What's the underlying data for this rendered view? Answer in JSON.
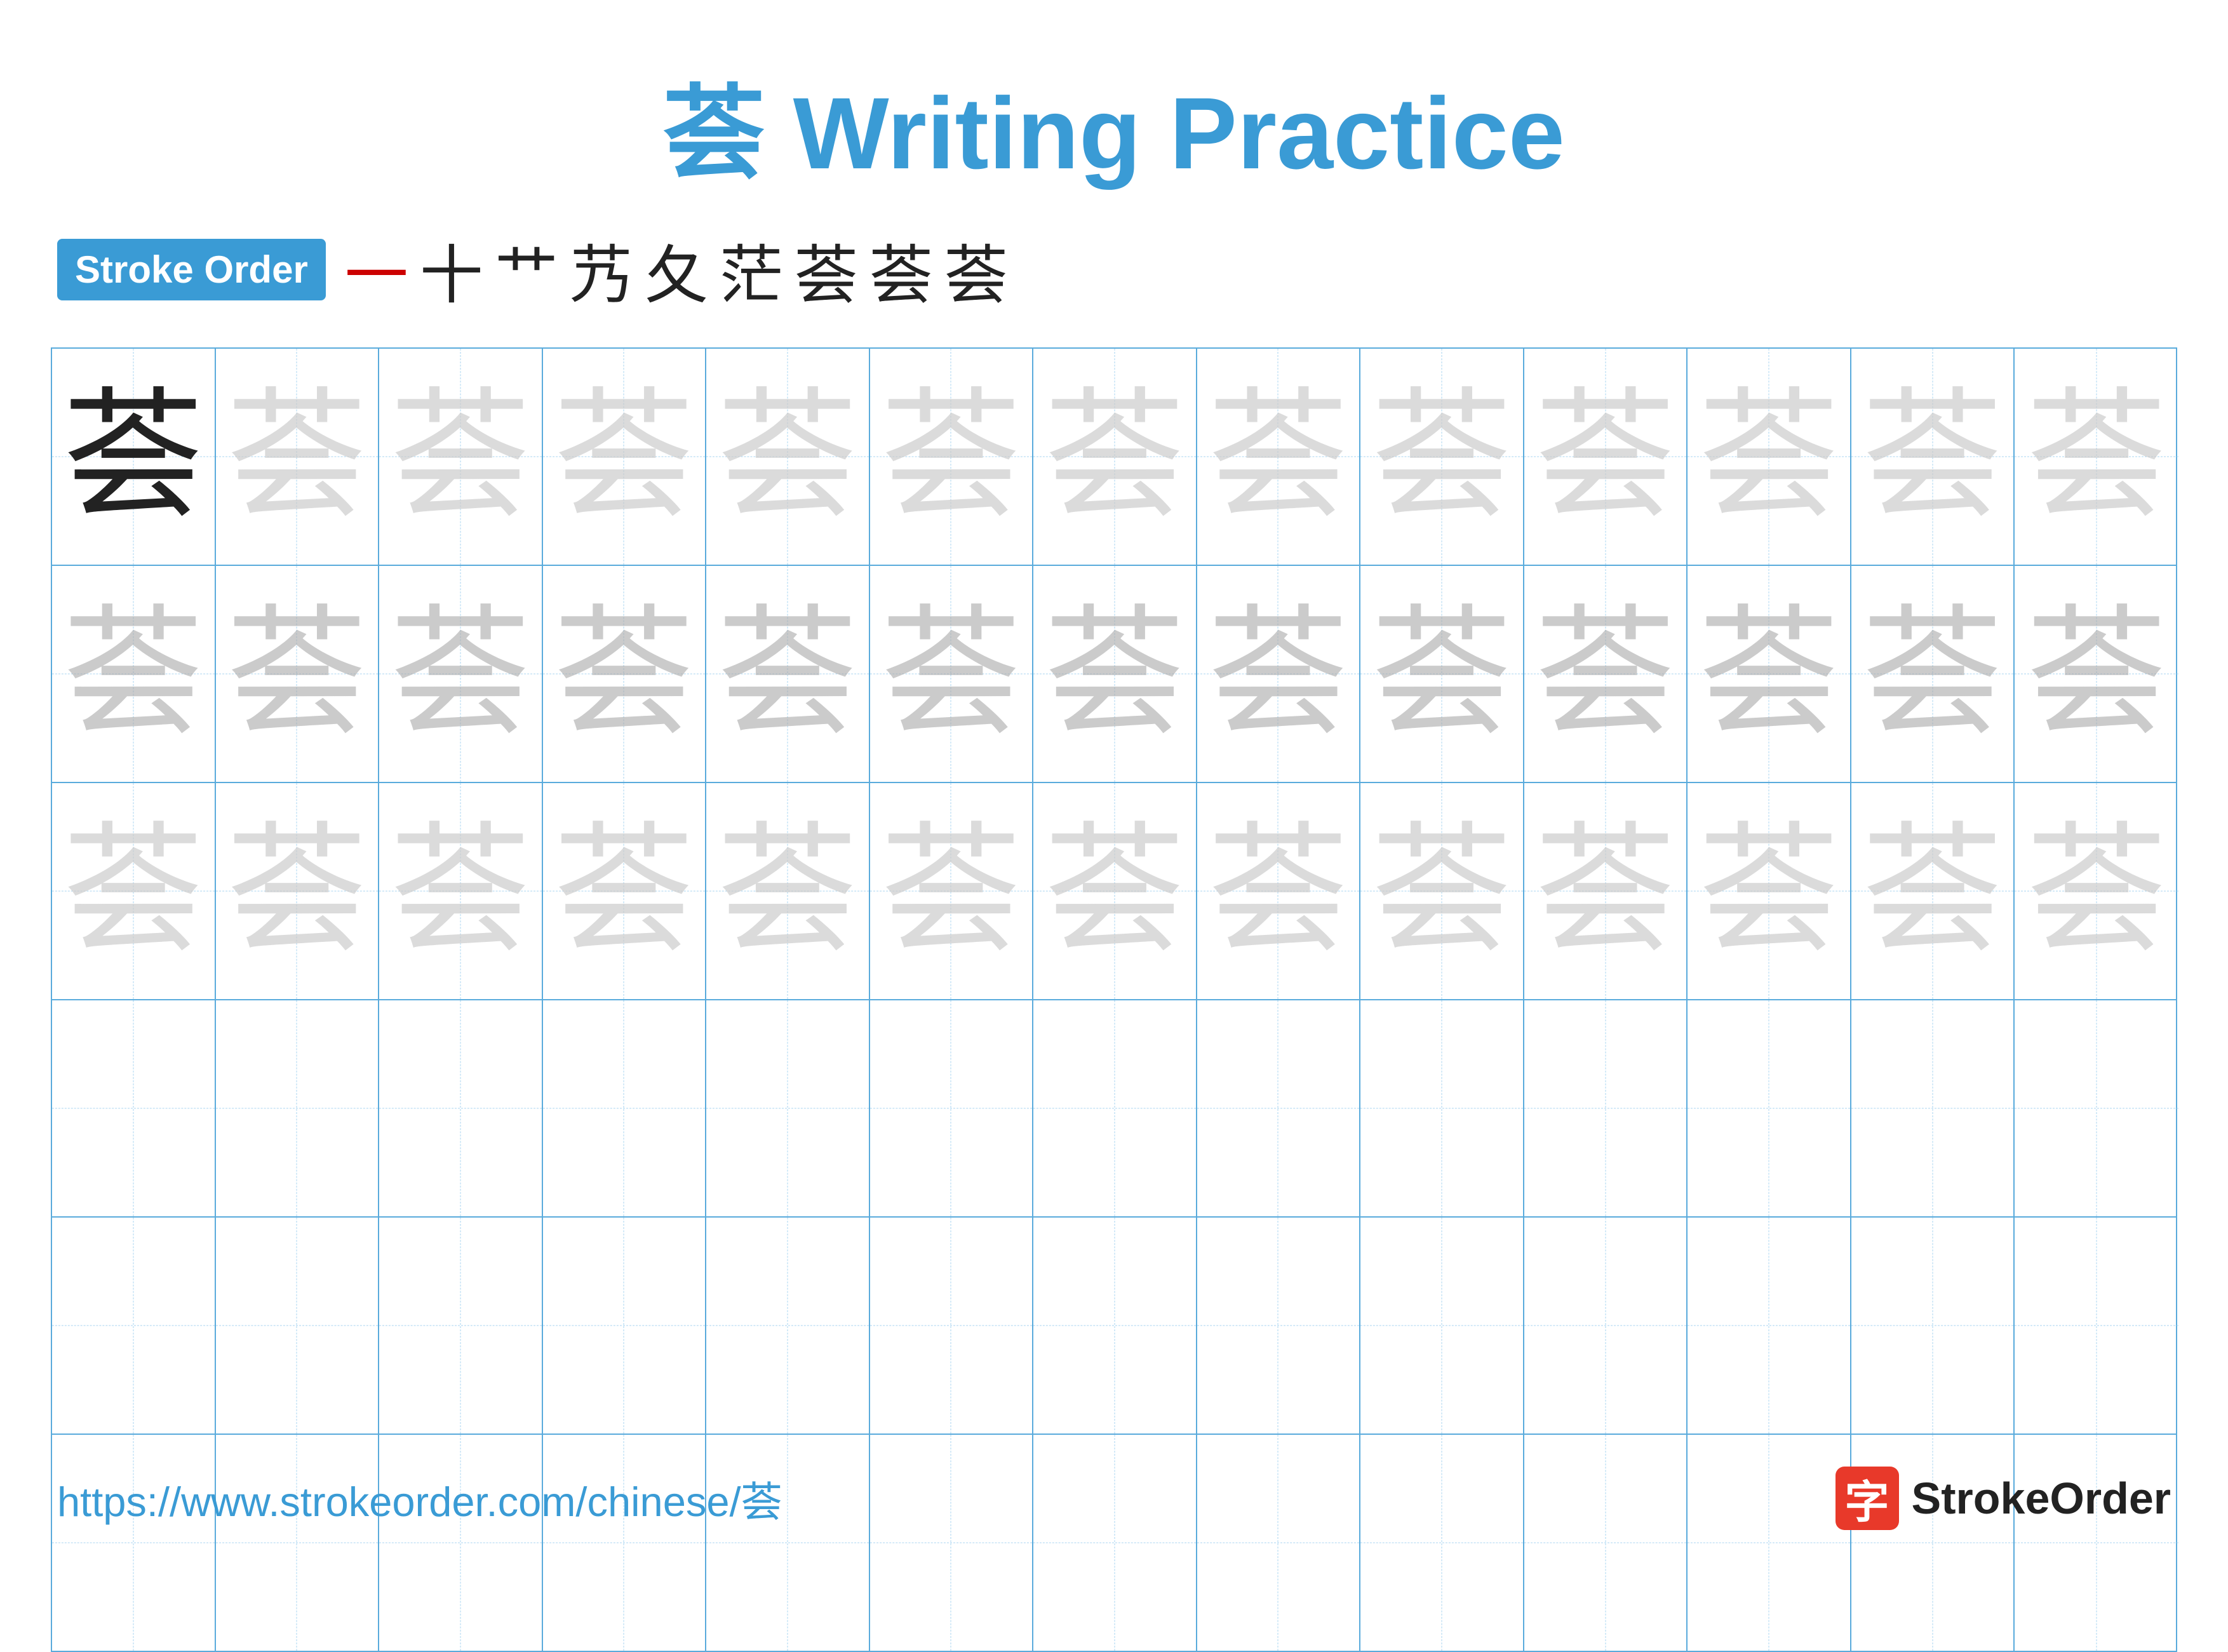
{
  "title": {
    "char": "荟",
    "text": " Writing Practice"
  },
  "stroke_order": {
    "badge_label": "Stroke Order",
    "strokes": [
      "一",
      "十",
      "艹",
      "艿",
      "夂",
      "茫",
      "荟",
      "荟",
      "荟"
    ]
  },
  "grid": {
    "rows": 6,
    "cols": 13,
    "char": "荟",
    "char_dark": "荟",
    "char_light": "荟"
  },
  "footer": {
    "url": "https://www.strokeorder.com/chinese/荟",
    "brand_icon": "字",
    "brand_text": "StrokeOrder"
  }
}
